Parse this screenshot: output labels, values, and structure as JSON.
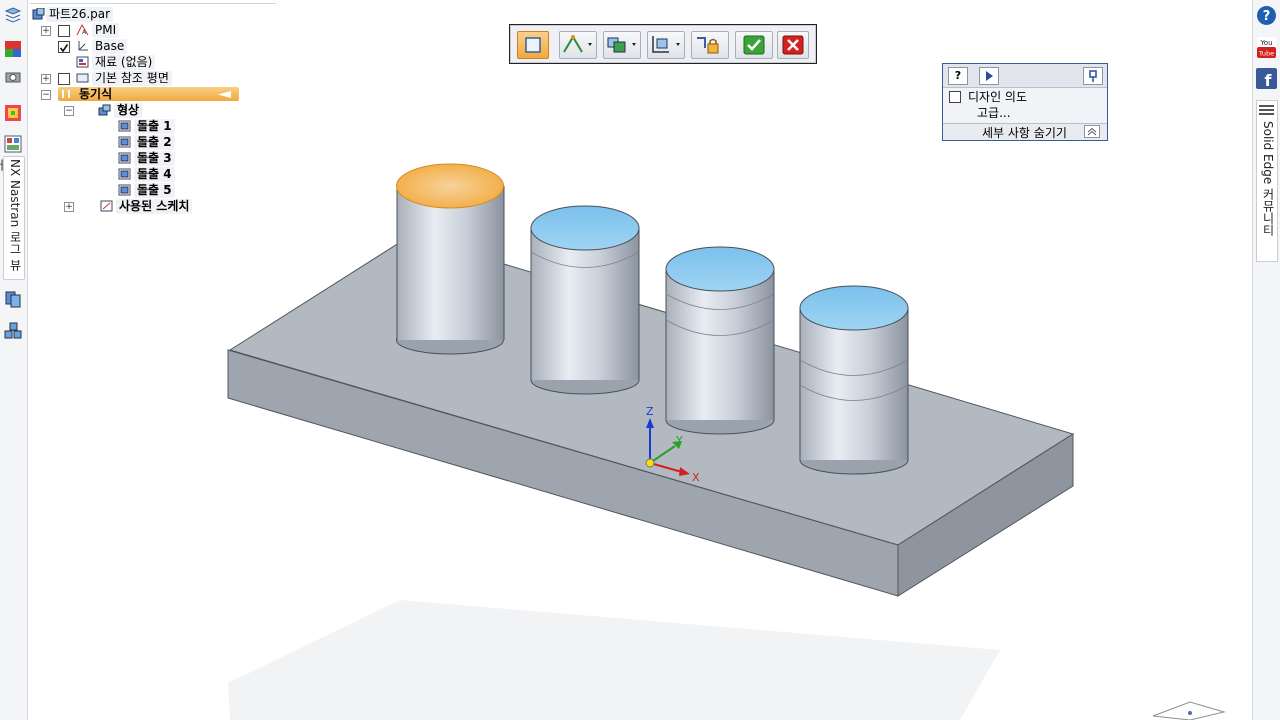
{
  "tree": {
    "root": "파트26.par",
    "pmi": "PMI",
    "base": "Base",
    "material": "재료 (없음)",
    "ref_planes": "기본 참조 평면",
    "sync": "동기식",
    "features": "형상",
    "extrudes": [
      "돌출 1",
      "돌출 2",
      "돌출 3",
      "돌출 4",
      "돌출 5"
    ],
    "used_sketches": "사용된 스케치"
  },
  "left_tab": "NX Nastran 로그 뷰어",
  "right_tab": "Solid Edge 커뮤니티",
  "design_panel": {
    "design_intent": "디자인 의도",
    "advanced": "고급...",
    "hide_details": "세부 사항 숨기기"
  },
  "axes": {
    "z": "Z",
    "y": "Y",
    "x": "X"
  },
  "colors": {
    "accent": "#f6b64a",
    "highlight_face": "#f2ad4a",
    "cyl_top": "#8ecbef",
    "body": "#a5acb5"
  },
  "icons": [
    "help-icon",
    "youtube-icon",
    "facebook-icon",
    "solidedge-icon",
    "accept-icon",
    "cancel-icon"
  ]
}
